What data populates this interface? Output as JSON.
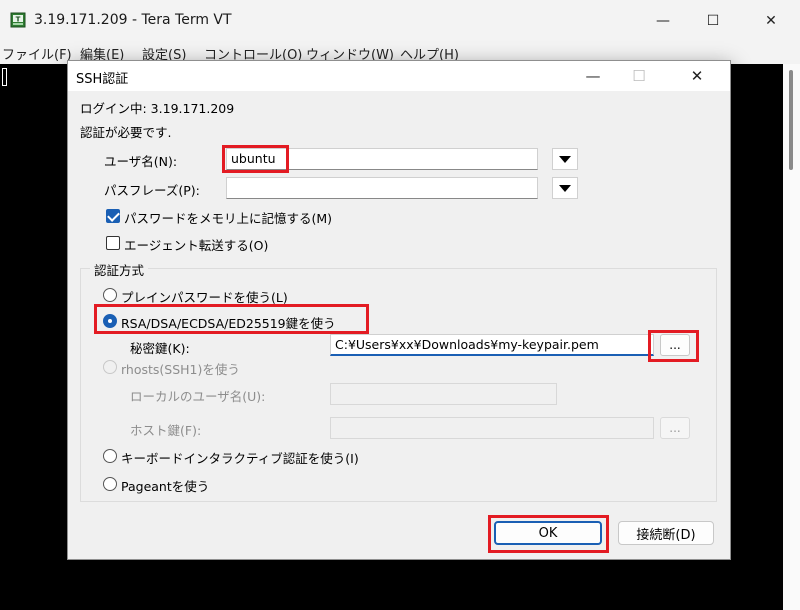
{
  "main_window": {
    "title": "3.19.171.209 - Tera Term VT",
    "minimize": "—",
    "maximize": "☐",
    "close": "✕",
    "menu": [
      "ファイル(F)",
      "編集(E)",
      "設定(S)",
      "コントロール(O)",
      "ウィンドウ(W)",
      "ヘルプ(H)"
    ]
  },
  "dialog": {
    "title": "SSH認証",
    "minimize": "—",
    "maximize": "☐",
    "close": "✕",
    "login_status": "ログイン中: 3.19.171.209",
    "auth_required": "認証が必要です.",
    "username_label": "ユーザ名(N):",
    "username_value": "ubuntu",
    "passphrase_label": "パスフレーズ(P):",
    "passphrase_value": "",
    "remember_password_label": "パスワードをメモリ上に記憶する(M)",
    "remember_password_checked": true,
    "agent_forward_label": "エージェント転送する(O)",
    "agent_forward_checked": false,
    "auth_method_group": "認証方式",
    "method_plain": "プレインパスワードを使う(L)",
    "method_rsa": "RSA/DSA/ECDSA/ED25519鍵を使う",
    "private_key_label": "秘密鍵(K):",
    "private_key_value": "C:¥Users¥xx¥Downloads¥my-keypair.pem",
    "browse_label": "...",
    "method_rhosts": "rhosts(SSH1)を使う",
    "local_user_label": "ローカルのユーザ名(U):",
    "host_key_label": "ホスト鍵(F):",
    "method_keyboard": "キーボードインタラクティブ認証を使う(I)",
    "method_pageant": "Pageantを使う",
    "ok_label": "OK",
    "disconnect_label": "接続断(D)"
  },
  "colors": {
    "accent": "#1a5fb4",
    "highlight": "#e31b23",
    "terminal_bg": "#000000"
  }
}
